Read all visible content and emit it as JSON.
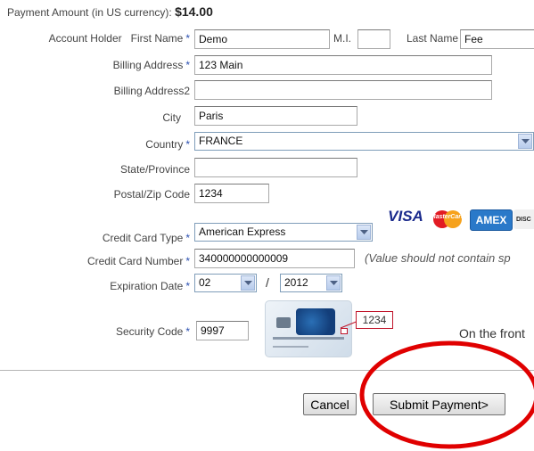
{
  "payment": {
    "label": "Payment Amount (in US currency):",
    "amount": "$14.00"
  },
  "account_holder": {
    "label": "Account Holder",
    "first_name_label": "First Name",
    "first_name": "Demo",
    "mi_label": "M.I.",
    "mi": "",
    "last_name_label": "Last Name",
    "last_name": "Fee"
  },
  "billing_address": {
    "label": "Billing Address",
    "value": "123 Main"
  },
  "billing_address2": {
    "label": "Billing Address2",
    "value": ""
  },
  "city": {
    "label": "City",
    "value": "Paris"
  },
  "country": {
    "label": "Country",
    "value": "FRANCE"
  },
  "state": {
    "label": "State/Province",
    "value": ""
  },
  "postal": {
    "label": "Postal/Zip Code",
    "value": "1234"
  },
  "card_type": {
    "label": "Credit Card Type",
    "value": "American Express"
  },
  "card_logos": {
    "visa": "VISA",
    "mastercard": "MasterCard",
    "amex": "AMEX",
    "discover": "DISC"
  },
  "card_number": {
    "label": "Credit Card Number",
    "value": "340000000000009",
    "hint": "(Value should not contain sp"
  },
  "expiration": {
    "label": "Expiration Date",
    "month": "02",
    "separator": "/",
    "year": "2012"
  },
  "security": {
    "label": "Security Code",
    "value": "9997",
    "example_code": "1234",
    "note": "On the front"
  },
  "required_mark": "*",
  "buttons": {
    "cancel": "Cancel",
    "submit": "Submit Payment>"
  },
  "colors": {
    "required": "#2a4fb0",
    "annotation_circle": "#e00000",
    "cvv_box": "#c0152a"
  }
}
